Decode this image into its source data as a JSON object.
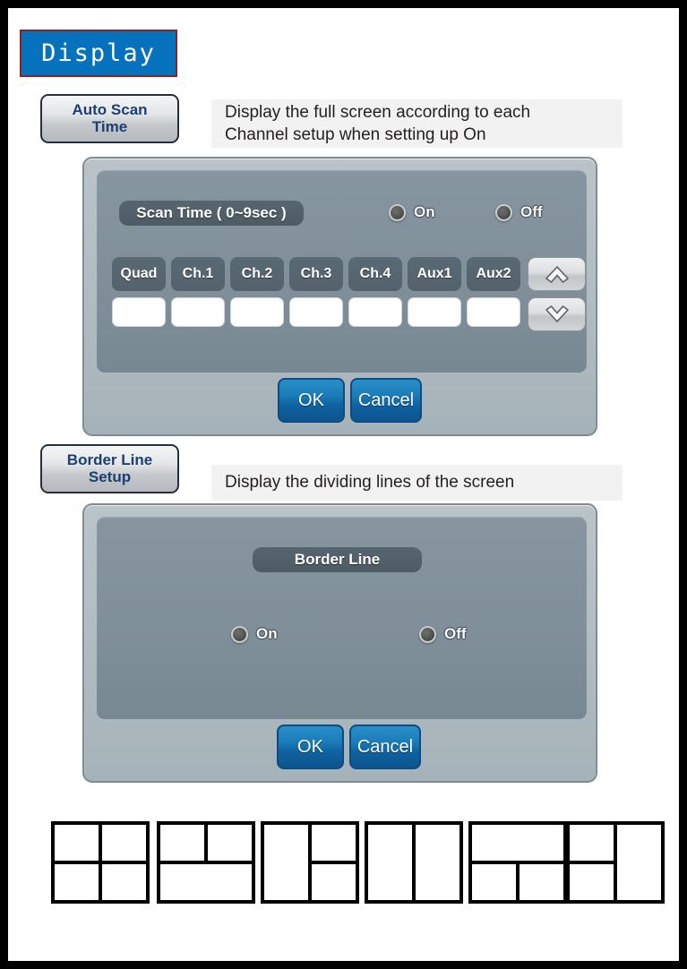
{
  "page": {
    "title": "Display"
  },
  "sections": [
    {
      "button_label_line1": "Auto Scan",
      "button_label_line2": "Time",
      "description_line1": "Display the full screen according to each",
      "description_line2": "Channel setup when setting up On",
      "dialog": {
        "pill_label": "Scan Time ( 0~9sec )",
        "radios": [
          {
            "label": "On",
            "selected": false
          },
          {
            "label": "Off",
            "selected": false
          }
        ],
        "channels": [
          {
            "label": "Quad",
            "value": ""
          },
          {
            "label": "Ch.1",
            "value": ""
          },
          {
            "label": "Ch.2",
            "value": ""
          },
          {
            "label": "Ch.3",
            "value": ""
          },
          {
            "label": "Ch.4",
            "value": ""
          },
          {
            "label": "Aux1",
            "value": ""
          },
          {
            "label": "Aux2",
            "value": ""
          }
        ],
        "arrows": [
          {
            "icon": "chevron-up-icon"
          },
          {
            "icon": "chevron-down-icon"
          }
        ],
        "ok_label": "OK",
        "cancel_label": "Cancel"
      }
    },
    {
      "button_label_line1": "Border Line",
      "button_label_line2": "Setup",
      "description_line1": "Display the dividing lines of the screen",
      "description_line2": "",
      "dialog": {
        "pill_label": "Border Line",
        "radios": [
          {
            "label": "On",
            "selected": false
          },
          {
            "label": "Off",
            "selected": false
          }
        ],
        "ok_label": "OK",
        "cancel_label": "Cancel"
      }
    }
  ],
  "screen_layouts": [
    {
      "name": "quad-2x2"
    },
    {
      "name": "two-top-one-bottom"
    },
    {
      "name": "one-left-two-right"
    },
    {
      "name": "two-columns"
    },
    {
      "name": "one-top-two-bottom"
    },
    {
      "name": "two-left-one-right"
    }
  ],
  "colors": {
    "title_background": "#0672bd",
    "title_border": "#8b2120",
    "dialog_background": "#b1bcc2",
    "inner_panel": "#808f9a",
    "pill": "#4d5b65",
    "action_button": "#1a7cb8",
    "description_background": "#f2f2f2"
  }
}
